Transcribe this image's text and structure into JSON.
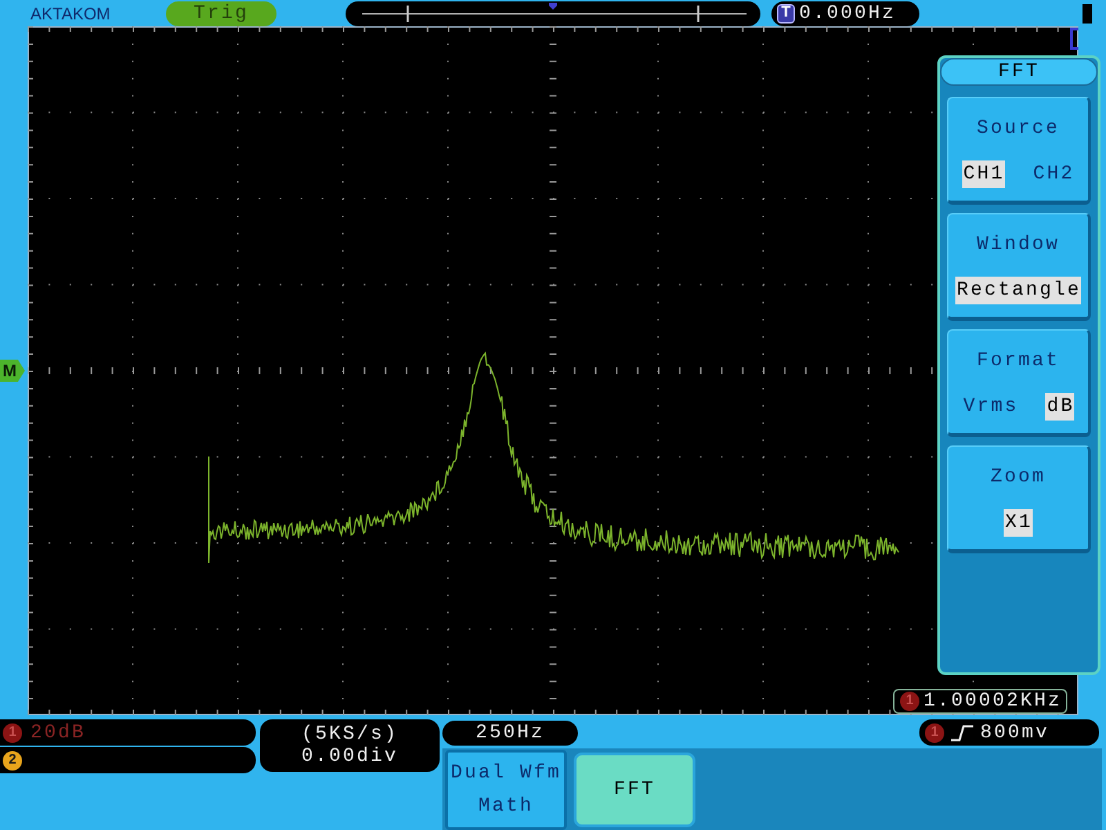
{
  "top_bar": {
    "brand": "AKTAKOM",
    "run_status": "Trig",
    "trigger_frequency": {
      "badge": "T",
      "value": "0.000Hz"
    }
  },
  "display": {
    "math_marker": "M",
    "frequency_counter": {
      "badge": "1",
      "value": "1.00002KHz"
    }
  },
  "fft_menu": {
    "title": "FFT",
    "items": [
      {
        "label": "Source",
        "options": [
          {
            "label": "CH1",
            "selected": true
          },
          {
            "label": "CH2",
            "selected": false
          }
        ]
      },
      {
        "label": "Window",
        "options": [
          {
            "label": "Rectangle",
            "selected": true
          }
        ]
      },
      {
        "label": "Format",
        "options": [
          {
            "label": "Vrms",
            "selected": false
          },
          {
            "label": "dB",
            "selected": true
          }
        ]
      },
      {
        "label": "Zoom",
        "options": [
          {
            "label": "X1",
            "selected": true
          }
        ]
      }
    ]
  },
  "status": {
    "channels": [
      {
        "badge": "1",
        "color": "#8c1414",
        "reading": "20dB"
      },
      {
        "badge": "2",
        "color": "#e8a41c"
      }
    ],
    "timebase": {
      "sample_rate": "(5KS/s)",
      "offset": "0.00div"
    },
    "frequency_scale": "250Hz",
    "trigger": {
      "badge": "1",
      "voltage": "800mv"
    }
  },
  "soft_menu": [
    {
      "label": "Dual Wfm Math",
      "selected": false
    },
    {
      "label": "FFT",
      "selected": true
    }
  ]
}
